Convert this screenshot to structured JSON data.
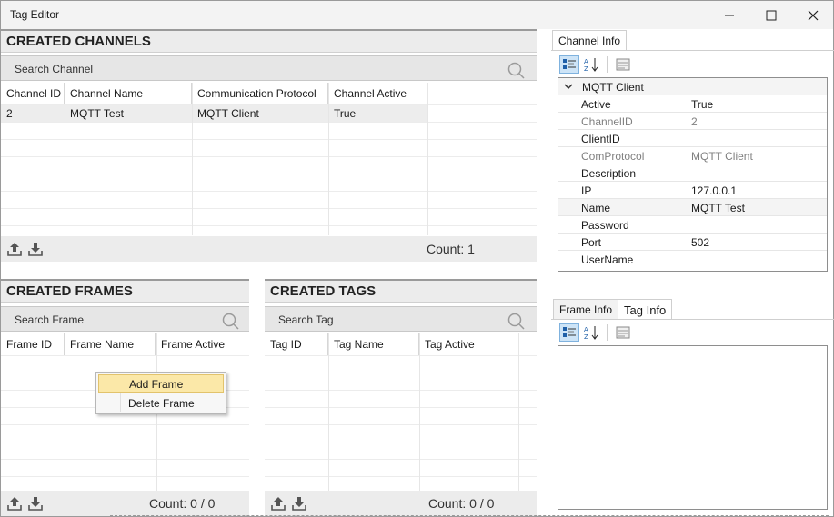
{
  "window": {
    "title": "Tag Editor"
  },
  "channels": {
    "heading": "CREATED CHANNELS",
    "search_placeholder": "Search Channel",
    "columns": [
      "Channel ID",
      "Channel Name",
      "Communication Protocol",
      "Channel Active"
    ],
    "rows": [
      [
        "2",
        "MQTT Test",
        "MQTT Client",
        "True"
      ]
    ],
    "count": "Count: 1"
  },
  "frames": {
    "heading": "CREATED FRAMES",
    "search_placeholder": "Search Frame",
    "columns": [
      "Frame ID",
      "Frame Name",
      "Frame Active"
    ],
    "count": "Count: 0 / 0"
  },
  "tags": {
    "heading": "CREATED TAGS",
    "search_placeholder": "Search Tag",
    "columns": [
      "Tag ID",
      "Tag Name",
      "Tag Active"
    ],
    "count": "Count: 0 / 0"
  },
  "context_menu": {
    "items": [
      "Add Frame",
      "Delete Frame"
    ],
    "highlighted": "Add Frame"
  },
  "channel_info": {
    "tab": "Channel Info",
    "category": "MQTT Client",
    "properties": [
      {
        "name": "Active",
        "value": "True",
        "readonly": false
      },
      {
        "name": "ChannelID",
        "value": "2",
        "readonly": true
      },
      {
        "name": "ClientID",
        "value": "",
        "readonly": false
      },
      {
        "name": "ComProtocol",
        "value": "MQTT Client",
        "readonly": true
      },
      {
        "name": "Description",
        "value": "",
        "readonly": false
      },
      {
        "name": "IP",
        "value": "127.0.0.1",
        "readonly": false
      },
      {
        "name": "Name",
        "value": "MQTT Test",
        "readonly": false
      },
      {
        "name": "Password",
        "value": "",
        "readonly": false
      },
      {
        "name": "Port",
        "value": "502",
        "readonly": false
      },
      {
        "name": "UserName",
        "value": "",
        "readonly": false
      }
    ]
  },
  "lower_tabs": {
    "items": [
      "Frame Info",
      "Tag Info"
    ],
    "active": "Tag Info"
  },
  "icons": {
    "upload": "upload-icon",
    "download": "download-icon",
    "search": "search-icon",
    "categorized": "categorized-icon",
    "alphabetical": "sort-alphabetical-icon",
    "property_pages": "property-pages-icon",
    "collapse": "chevron-down-icon"
  },
  "colors": {
    "header_bg": "#ececec",
    "selection": "#cde4f7",
    "menu_highlight": "#fbe8a8"
  }
}
